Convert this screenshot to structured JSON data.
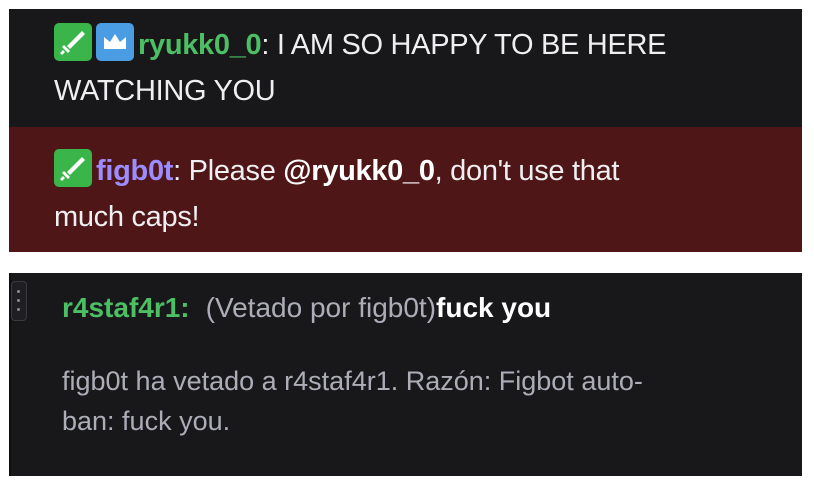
{
  "chat": {
    "message1": {
      "username": "ryukk0_0",
      "separator": ":",
      "text_line1": " I AM SO HAPPY TO BE HERE",
      "text_line2": "WATCHING YOU",
      "badges": [
        "sword-icon",
        "crown-icon"
      ]
    },
    "message2": {
      "username": "figb0t",
      "separator": ":",
      "text_before": " Please ",
      "mention": "@ryukk0_0",
      "text_after": ", don't use that",
      "text_line2": "much caps!",
      "badges": [
        "sword-icon"
      ]
    },
    "message3": {
      "username": "r4staf4r1:",
      "note": "(Vetado por figb0t)",
      "text": "fuck you"
    },
    "system": {
      "line1": "figb0t ha vetado a r4staf4r1. Razón: Figbot auto-",
      "line2": "ban: fuck you."
    }
  },
  "colors": {
    "background": "#18181b",
    "highlight": "#4f1618",
    "username_green": "#4cbe63",
    "username_purple": "#9b8cff",
    "mod_badge": "#39b54a",
    "vip_badge": "#4a9ce3"
  }
}
